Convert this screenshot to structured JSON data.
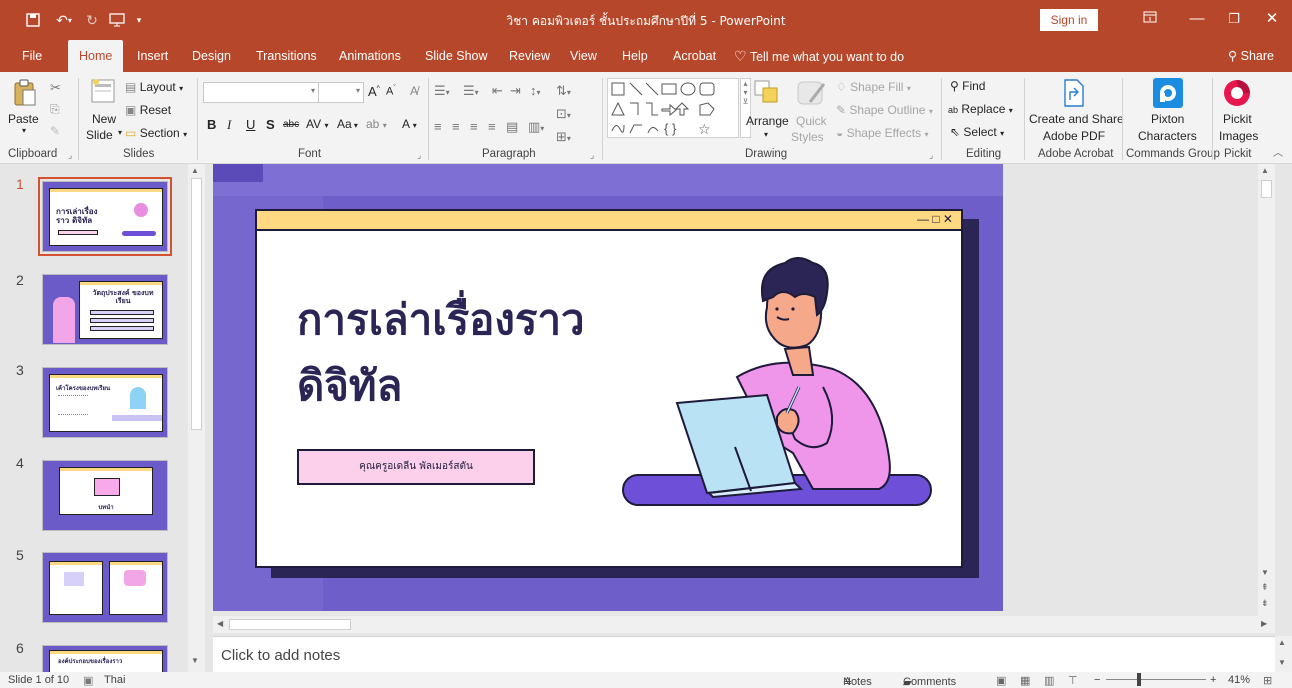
{
  "app": {
    "title": "วิชา คอมพิวเตอร์ ชั้นประถมศึกษาปีที่ 5  -  PowerPoint",
    "sign_in": "Sign in"
  },
  "menu": {
    "tabs": [
      "File",
      "Home",
      "Insert",
      "Design",
      "Transitions",
      "Animations",
      "Slide Show",
      "Review",
      "View",
      "Help",
      "Acrobat"
    ],
    "tell_me": "Tell me what you want to do",
    "share": "Share"
  },
  "ribbon": {
    "clipboard": {
      "paste": "Paste",
      "label": "Clipboard"
    },
    "slides": {
      "layout": "Layout",
      "reset": "Reset",
      "section": "Section",
      "new_slide_1": "New",
      "new_slide_2": "Slide",
      "label": "Slides"
    },
    "font": {
      "label": "Font",
      "aa": "Aa"
    },
    "paragraph": {
      "label": "Paragraph"
    },
    "drawing": {
      "arrange": "Arrange",
      "quick_1": "Quick",
      "quick_2": "Styles",
      "shape_fill": "Shape Fill",
      "shape_outline": "Shape Outline",
      "shape_effects": "Shape Effects",
      "label": "Drawing"
    },
    "editing": {
      "find": "Find",
      "replace": "Replace",
      "select": "Select",
      "label": "Editing"
    },
    "acrobat": {
      "create_1": "Create and Share",
      "create_2": "Adobe PDF",
      "label": "Adobe Acrobat"
    },
    "commands": {
      "pixton_1": "Pixton",
      "pixton_2": "Characters",
      "label": "Commands Group"
    },
    "pickit": {
      "pickit_1": "Pickit",
      "pickit_2": "Images",
      "label": "Pickit"
    }
  },
  "thumbnails": {
    "numbers": [
      "1",
      "2",
      "3",
      "4",
      "5",
      "6"
    ],
    "slide1_title": "การเล่าเรื่องราว ดิจิทัล",
    "slide2_title": "วัตถุประสงค์ ของบทเรียน",
    "slide3_title": "เค้าโครงของบทเรียน",
    "slide4_title": "บทนำ",
    "slide6_title": "องค์ประกอบของเรื่องราว"
  },
  "slide": {
    "title_line1": "การเล่าเรื่องราว",
    "title_line2": "ดิจิทัล",
    "author": "คุณครูอเดลีน พัลเมอร์สตัน",
    "window_controls": "— □ ✕"
  },
  "notes": {
    "placeholder": "Click to add notes"
  },
  "status": {
    "slide_info": "Slide 1 of 10",
    "language": "Thai",
    "notes": "Notes",
    "comments": "Comments",
    "zoom": "41%"
  },
  "colors": {
    "accent": "#b7472a",
    "slide_bg": "#6d5ec9",
    "window_bar": "#ffd982",
    "author_box": "#fcd0ea",
    "title_text": "#2a2555"
  }
}
